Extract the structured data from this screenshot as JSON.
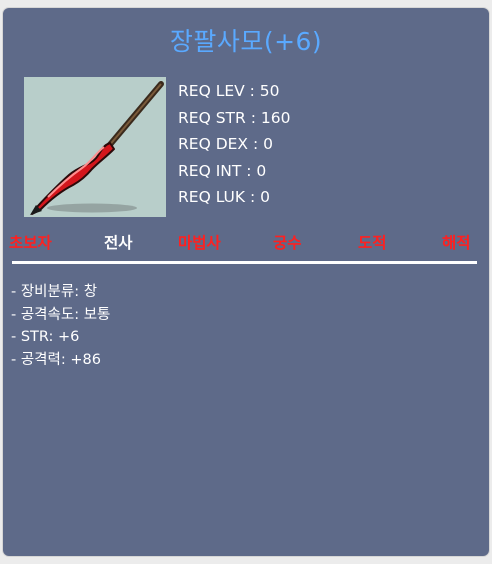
{
  "item": {
    "name": "장팔사모(+6)",
    "image_icon": "red-spear-icon"
  },
  "requirements": [
    {
      "label": "REQ LEV",
      "value": "50"
    },
    {
      "label": "REQ STR",
      "value": "160"
    },
    {
      "label": "REQ DEX",
      "value": "0"
    },
    {
      "label": "REQ INT",
      "value": "0"
    },
    {
      "label": "REQ LUK",
      "value": "0"
    }
  ],
  "requirement_lines": [
    "REQ LEV : 50",
    "REQ STR : 160",
    "REQ DEX : 0",
    "REQ INT : 0",
    "REQ LUK : 0"
  ],
  "classes": [
    {
      "name": "초보자",
      "eligible": false
    },
    {
      "name": "전사",
      "eligible": true
    },
    {
      "name": "마법사",
      "eligible": false
    },
    {
      "name": "궁수",
      "eligible": false
    },
    {
      "name": "도적",
      "eligible": false
    },
    {
      "name": "해적",
      "eligible": false
    }
  ],
  "stats": [
    "- 장비분류: 창",
    "- 공격속도: 보통",
    "- STR: +6",
    "- 공격력: +86"
  ],
  "colors": {
    "panel": "#5e6a89",
    "title": "#5aa9ff",
    "ineligible": "#ff2020",
    "eligible": "#ffffff",
    "text": "#ffffff"
  }
}
